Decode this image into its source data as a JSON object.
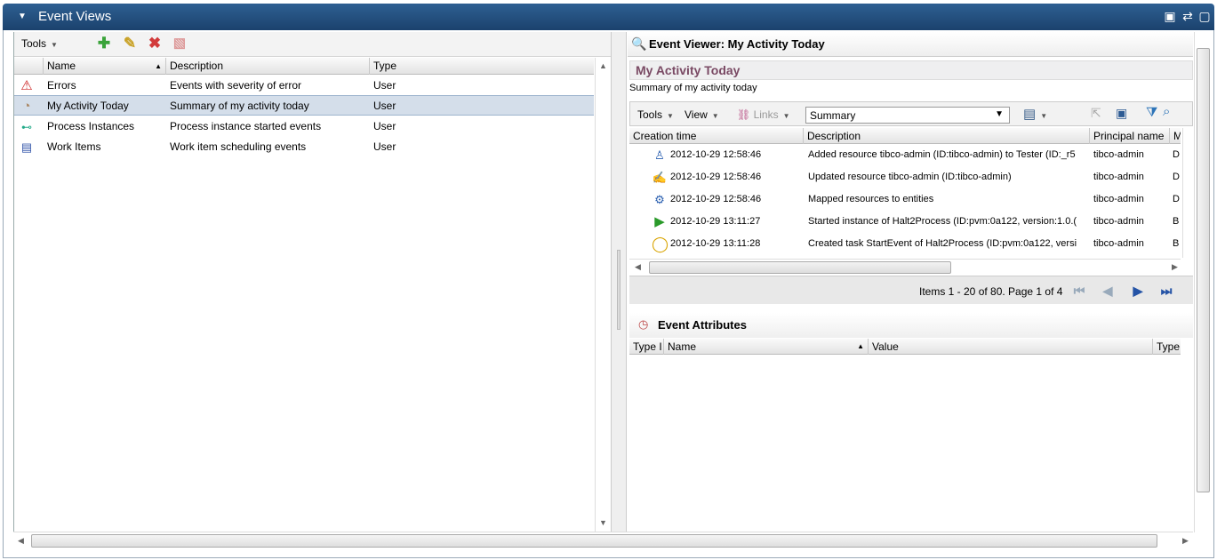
{
  "window": {
    "title": "Event Views"
  },
  "left": {
    "tools_label": "Tools",
    "columns": [
      "Name",
      "Description",
      "Type"
    ],
    "rows": [
      {
        "icon": "error-icon",
        "name": "Errors",
        "description": "Events with severity of error",
        "type": "User"
      },
      {
        "icon": "activity-icon",
        "name": "My Activity Today",
        "description": "Summary of my activity today",
        "type": "User"
      },
      {
        "icon": "process-icon",
        "name": "Process Instances",
        "description": "Process instance started events",
        "type": "User"
      },
      {
        "icon": "workitem-icon",
        "name": "Work Items",
        "description": "Work item scheduling events",
        "type": "User"
      }
    ]
  },
  "right": {
    "header_title": "Event Viewer: My Activity Today",
    "view_title": "My Activity Today",
    "view_summary": "Summary of my activity today",
    "toolbar": {
      "tools": "Tools",
      "view": "View",
      "links": "Links",
      "select_value": "Summary"
    },
    "columns": [
      "Creation time",
      "Description",
      "Principal name",
      "M"
    ],
    "rows": [
      {
        "time": "2012-10-29 12:58:46",
        "description": "Added resource tibco-admin (ID:tibco-admin) to Tester (ID:_r5",
        "principal": "tibco-admin",
        "m": "D"
      },
      {
        "time": "2012-10-29 12:58:46",
        "description": "Updated resource tibco-admin (ID:tibco-admin)",
        "principal": "tibco-admin",
        "m": "D"
      },
      {
        "time": "2012-10-29 12:58:46",
        "description": "Mapped resources to entities",
        "principal": "tibco-admin",
        "m": "D"
      },
      {
        "time": "2012-10-29 13:11:27",
        "description": "Started instance of Halt2Process (ID:pvm:0a122, version:1.0.(",
        "principal": "tibco-admin",
        "m": "B"
      },
      {
        "time": "2012-10-29 13:11:28",
        "description": "Created task StartEvent of Halt2Process (ID:pvm:0a122, versi",
        "principal": "tibco-admin",
        "m": "B"
      }
    ],
    "pager_text": "Items 1 - 20 of 80. Page 1 of 4",
    "attributes_title": "Event Attributes",
    "attr_columns": [
      "Type I",
      "Name",
      "Value",
      "Type"
    ]
  }
}
